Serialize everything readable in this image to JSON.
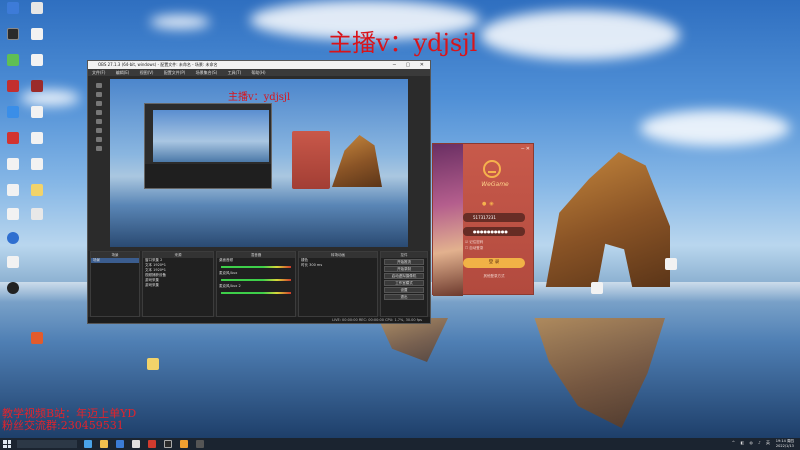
{
  "watermarks": {
    "anchor": "主播v：ydjsjl",
    "bili_line1": "教学视频B站：年迈上单YD",
    "bili_line2": "粉丝交流群:230459531",
    "preview_anchor": "主播v：ydjsjl"
  },
  "obs": {
    "title": "OBS 27.1.3 (64-bit, windows) - 配置文件: 未命名 - 场景: 未命名",
    "menu": [
      "文件(F)",
      "编辑(E)",
      "视图(V)",
      "配置文件(P)",
      "场景集合(S)",
      "工具(T)",
      "帮助(H)"
    ],
    "docks": {
      "scenes_title": "场景",
      "scenes": [
        "场景"
      ],
      "sources_title": "来源",
      "sources": [
        "窗口采集 2",
        "文本 1920*1",
        "文本 1920*1",
        "视频捕获设备",
        "游戏采集",
        "游戏采集"
      ],
      "mixer_title": "混音器",
      "mixer_items": [
        "桌面音频",
        "麦克风/Aux",
        "麦克风/Aux 2"
      ],
      "transitions_title": "转场动画",
      "transition": "褪色",
      "duration_label": "时长",
      "duration_value": "300 ms",
      "controls_title": "控件",
      "controls": [
        "开始推流",
        "开始录制",
        "启动虚拟摄像机",
        "工作室模式",
        "设置",
        "退出"
      ]
    },
    "status": "LIVE: 00:00:00   REC: 00:00:00   CPU: 1.7%, 30.00 fps"
  },
  "wegame": {
    "brand": "WeGame",
    "account": "517317231",
    "password": "●●●●●●●●●●",
    "remember": "记住密码",
    "autologin": "自动登录",
    "login_button": "登 录",
    "other_login": "其他登录方式"
  },
  "taskbar": {
    "clock_time": "19:14 周四",
    "clock_date": "2022/1/13"
  },
  "colors": {
    "watermark_red": "#d9141a",
    "wegame_orange": "#f1b246",
    "wegame_panel": "#c85a4b"
  }
}
